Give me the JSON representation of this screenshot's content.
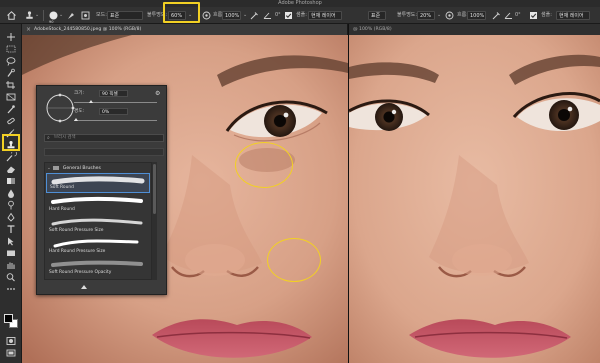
{
  "app": {
    "title": "Adobe Photoshop"
  },
  "options_bar": {
    "mode_label": "모드:",
    "mode_value": "표준",
    "opacity_label": "불투명도:",
    "opacity_value": "60%",
    "flow_label": "흐름:",
    "flow_value": "100%",
    "angle_value": "0°",
    "sample_label": "샘플:",
    "sample_value": "현재 레이어",
    "right_mode_value": "표준",
    "right_opacity_label": "불투명도:",
    "right_opacity_value": "20%",
    "right_flow_label": "흐름:",
    "right_flow_value": "100%",
    "right_angle_value": "0°",
    "right_sample_label": "샘플:",
    "right_sample_value": "현재 레이어",
    "brush_size_value": "90",
    "highlight_color": "#f2d024"
  },
  "tabs": {
    "left_tab_label": "AdobeStock_244580850.jpeg @ 100% (RGB/8)",
    "right_tab_label": "@ 100% (RGB/8)"
  },
  "brush_popup": {
    "size_label": "크기:",
    "size_value": "90 픽셀",
    "hardness_label": "경도:",
    "hardness_value": "0%",
    "search_placeholder": "브러시 검색",
    "group_label": "General Brushes",
    "presets": [
      {
        "name": "Soft Round",
        "selected": true
      },
      {
        "name": "Hard Round",
        "selected": false
      },
      {
        "name": "Soft Round Pressure Size",
        "selected": false
      },
      {
        "name": "Hard Round Pressure Size",
        "selected": false
      },
      {
        "name": "Soft Round Pressure Opacity",
        "selected": false
      }
    ]
  },
  "toolbar": {
    "active_tool": "clone-stamp-icon",
    "tools": [
      "move-icon",
      "marquee-icon",
      "lasso-icon",
      "quick-select-icon",
      "crop-icon",
      "frame-icon",
      "eyedropper-icon",
      "spot-healing-icon",
      "brush-icon",
      "clone-stamp-icon",
      "history-brush-icon",
      "eraser-icon",
      "gradient-icon",
      "blur-icon",
      "dodge-icon",
      "pen-icon",
      "type-icon",
      "path-select-icon",
      "rectangle-icon",
      "hand-icon",
      "zoom-icon",
      "more-tools-icon"
    ]
  },
  "colors": {
    "foreground": "#000000",
    "background": "#ffffff",
    "annotation_ring": "#f2d024"
  }
}
